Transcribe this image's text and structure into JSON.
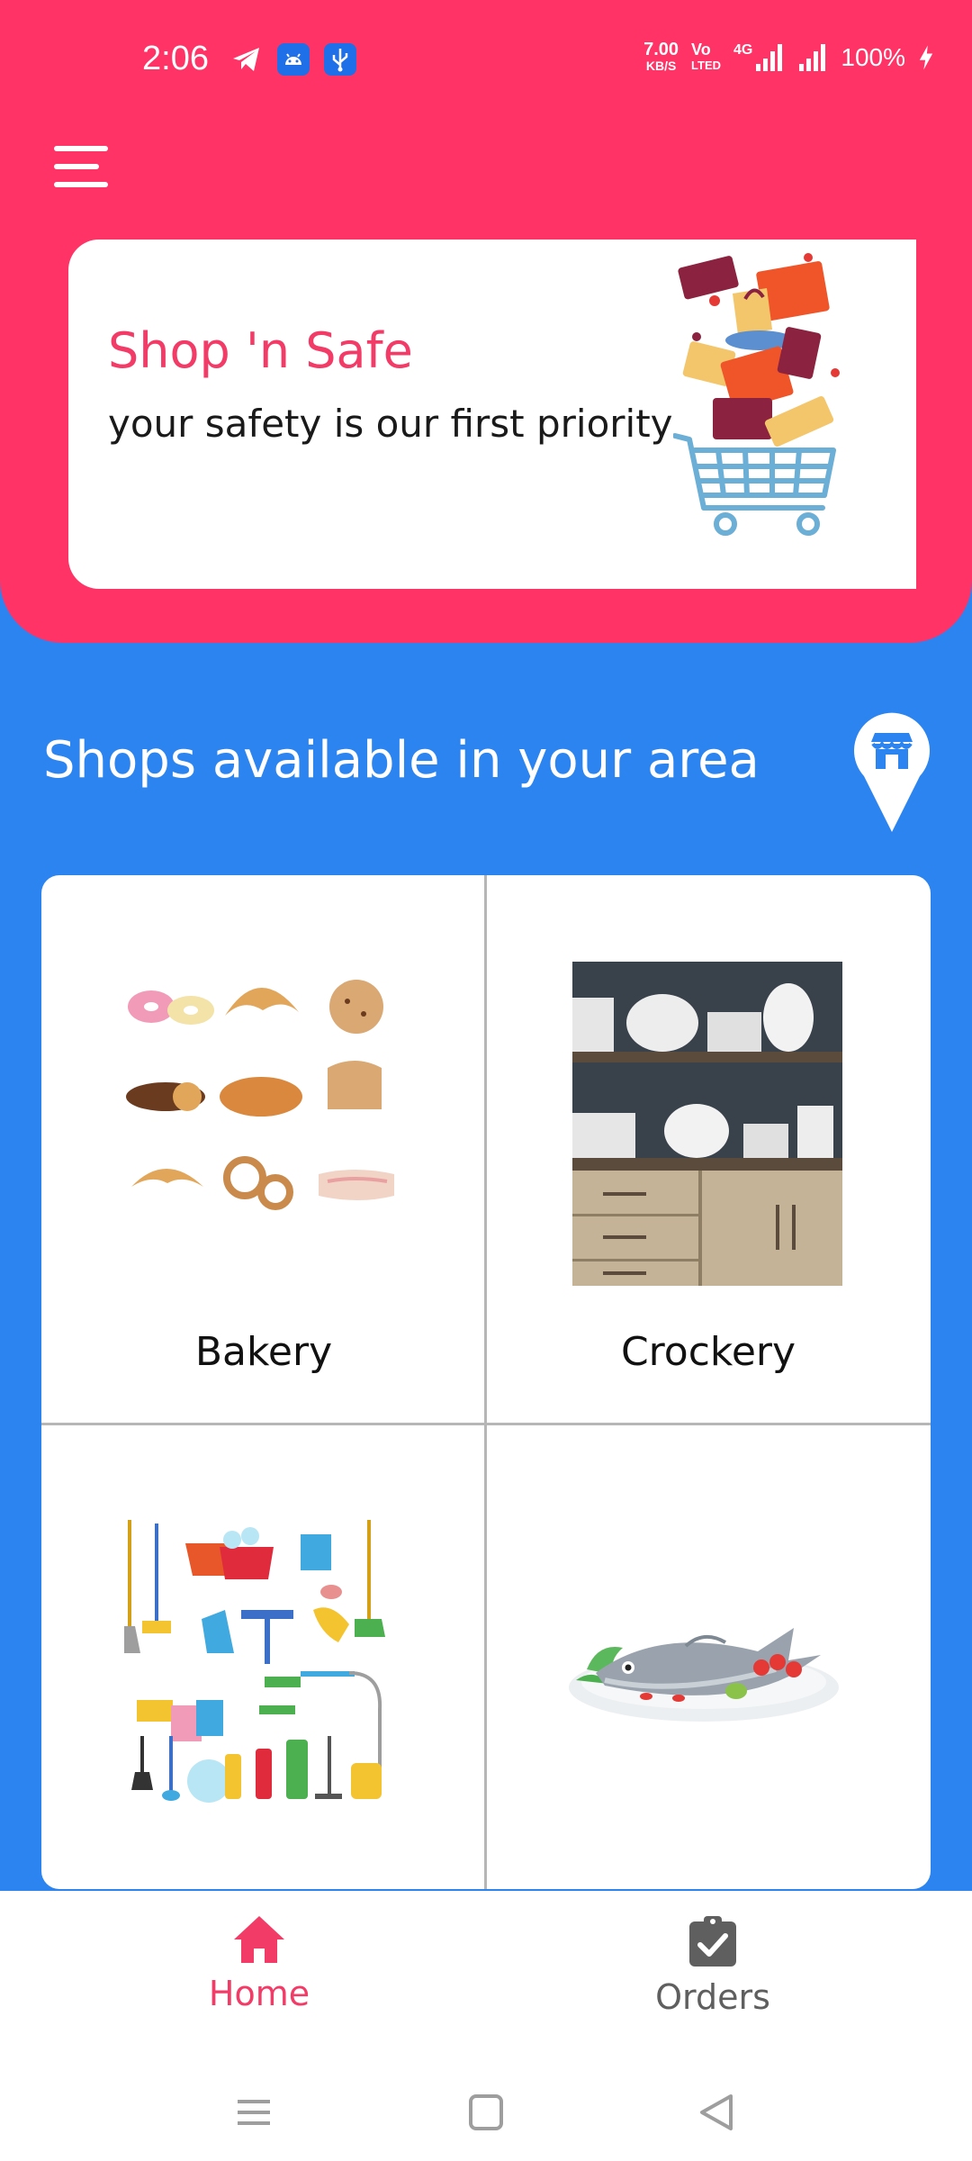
{
  "status_bar": {
    "time": "2:06",
    "speed_value": "7.00",
    "speed_unit": "KB/S",
    "volte_top": "Vo",
    "volte_bottom": "LTED",
    "network": "4G",
    "battery": "100%"
  },
  "header": {
    "banner_title": "Shop 'n Safe",
    "banner_subtitle": "your safety is our first priority"
  },
  "shops": {
    "title": "Shops available in your area",
    "items": [
      {
        "name": "Bakery"
      },
      {
        "name": "Crockery"
      },
      {
        "name": ""
      },
      {
        "name": ""
      }
    ]
  },
  "bottom_nav": {
    "items": [
      {
        "label": "Home",
        "active": true
      },
      {
        "label": "Orders",
        "active": false
      }
    ]
  },
  "colors": {
    "primary": "#FF3366",
    "secondary": "#2B84F0",
    "active_nav": "#F23B66",
    "inactive_nav": "#5f5f5f"
  }
}
